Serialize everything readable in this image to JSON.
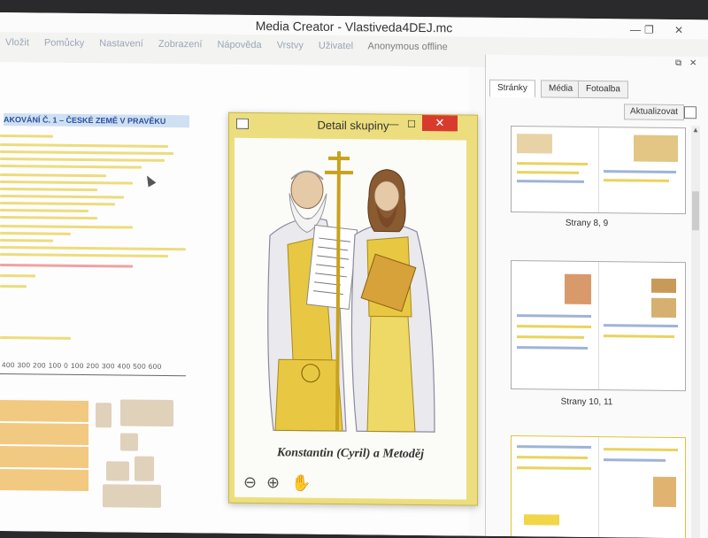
{
  "window": {
    "title": "Media Creator - Vlastiveda4DEJ.mc"
  },
  "menu": [
    "Vložit",
    "Pomůcky",
    "Nastavení",
    "Zobrazení",
    "Nápověda",
    "Vrstvy",
    "Uživatel"
  ],
  "user_status": "Anonymous offline",
  "document": {
    "heading": "AKOVÁNÍ Č. 1 – ČESKÉ ZEMĚ V PRAVĚKU",
    "timeline_numbers": "400 300 200 100 0 100 200 300 400 500 600"
  },
  "popup": {
    "title": "Detail skupiny",
    "caption": "Konstantin (Cyril) a Metoděj",
    "tools": {
      "zoom_out": "zoom-out-icon",
      "zoom_in": "zoom-in-icon",
      "pan": "hand-icon"
    }
  },
  "sidebar": {
    "tabs": [
      "Stránky",
      "Média",
      "Fotoalba"
    ],
    "active_tab": "Stránky",
    "refresh_label": "Aktualizovat",
    "pages": [
      {
        "label": "Strany 8, 9"
      },
      {
        "label": "Strany 10, 11"
      }
    ]
  },
  "colors": {
    "popup_frame": "#ecde7e",
    "close_button": "#d83b2e",
    "accent_blue": "#2b4fa0"
  }
}
